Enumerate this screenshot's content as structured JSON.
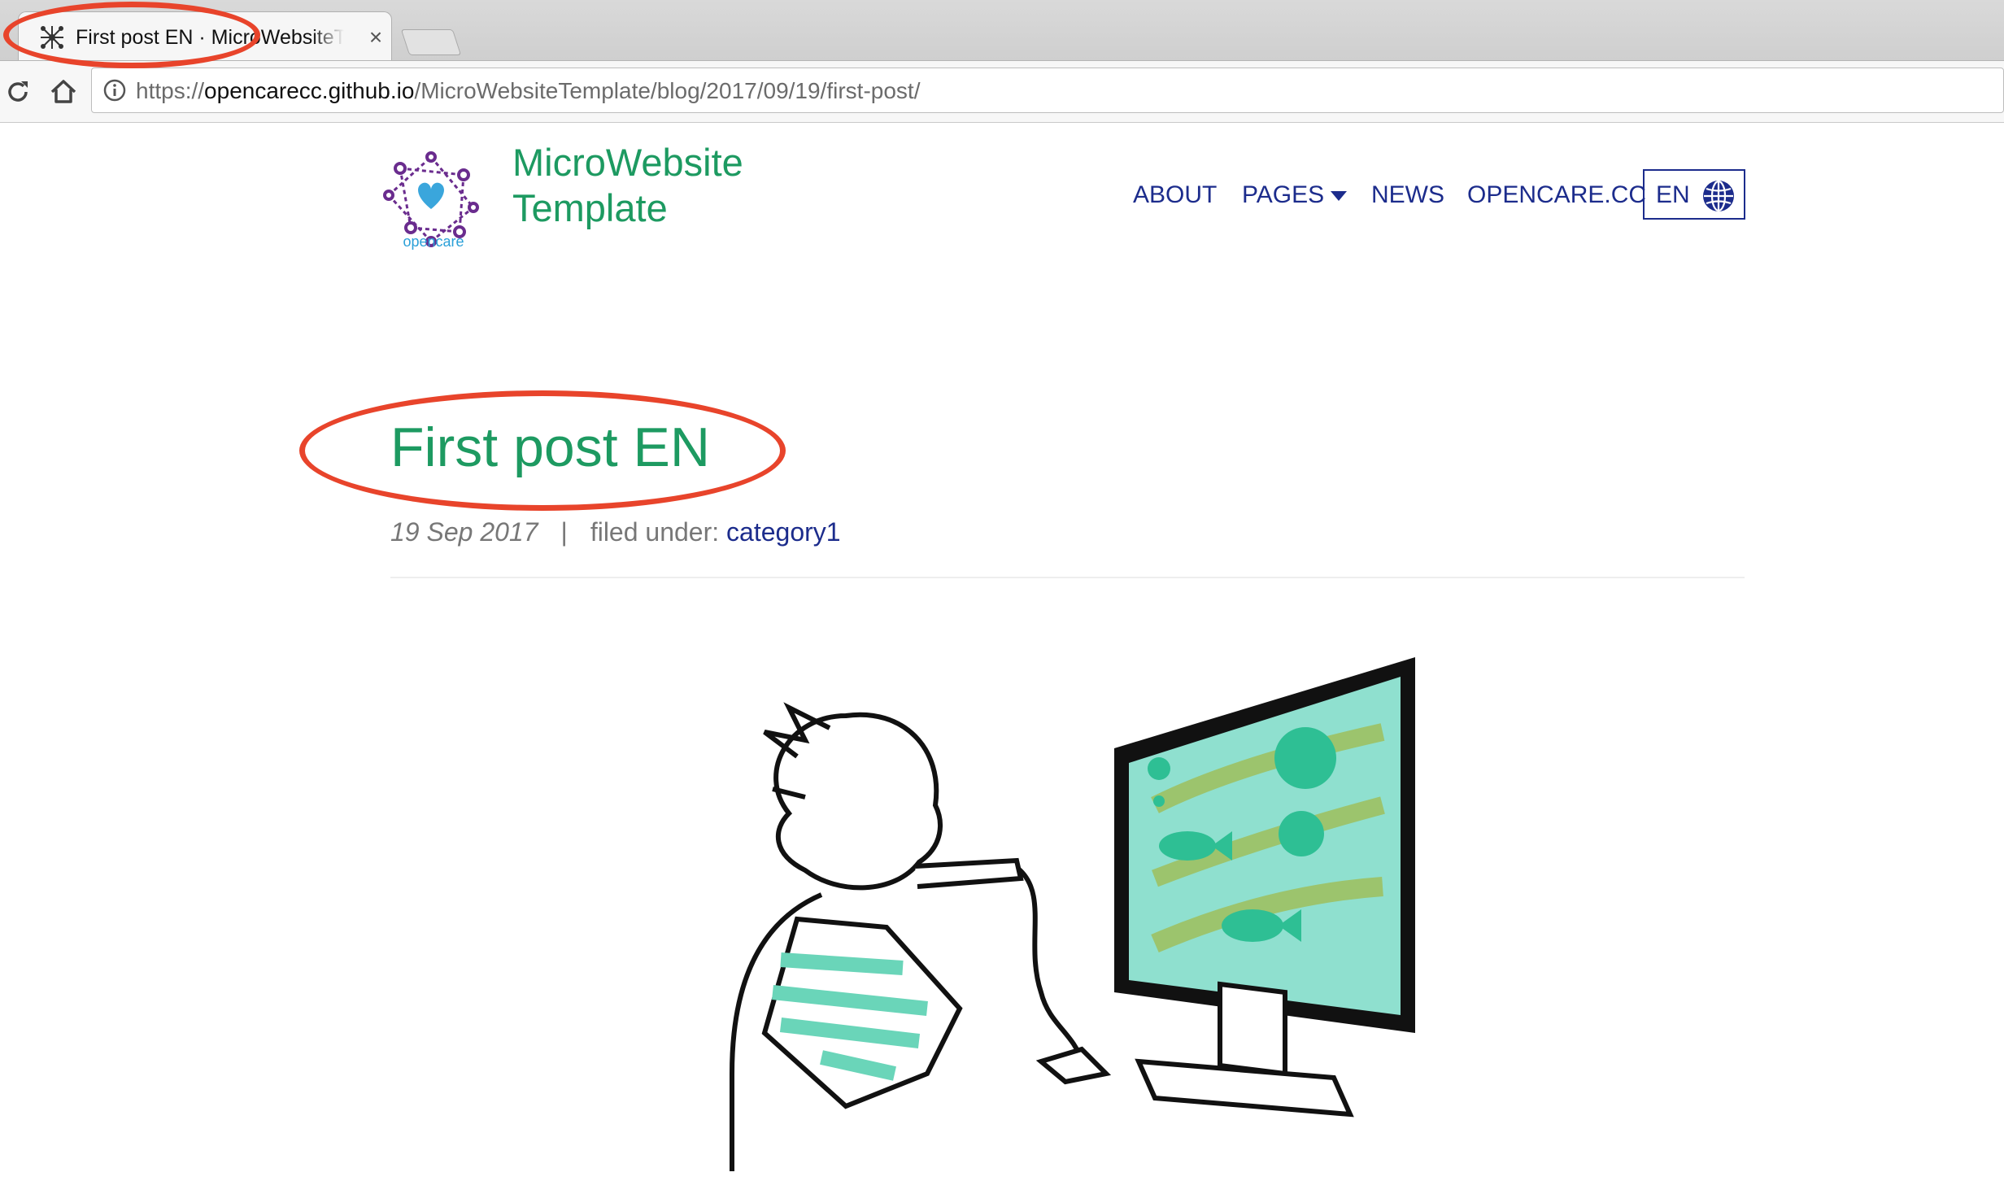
{
  "browser": {
    "tab": {
      "title": "First post EN · MicroWebsiteTemplate",
      "close": "×"
    },
    "url": {
      "scheme": "https://",
      "host": "opencarecc.github.io",
      "path": "/MicroWebsiteTemplate/blog/2017/09/19/first-post/"
    }
  },
  "site": {
    "logo_text": "opencare",
    "title_line1": "MicroWebsite",
    "title_line2": "Template"
  },
  "nav": {
    "about": "ABOUT",
    "pages": "PAGES",
    "news": "NEWS",
    "opencare": "OPENCARE.CC",
    "language": "EN"
  },
  "post": {
    "title": "First post EN",
    "date": "19 Sep 2017",
    "separator": "|",
    "filed_under_label": "filed under:",
    "category": "category1"
  },
  "colors": {
    "accent_green": "#1d9a61",
    "nav_blue": "#1c2c8c",
    "annotation_red": "#e8442b"
  }
}
